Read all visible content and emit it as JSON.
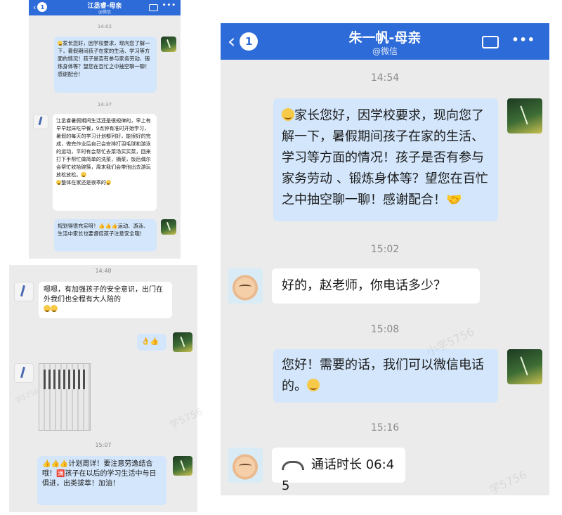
{
  "left_top": {
    "title": "江丞睿-母亲",
    "subtitle": "@微信",
    "back_count": "1",
    "times": [
      "14:02",
      "14:37"
    ],
    "msg1": "家长您好，因学校要求，现向您了解一下，暑假期间孩子在家的生活、学习等方面的情况！孩子是否有参与家务劳动、锻炼身体等？望您在百忙之中抽空聊一聊！感谢配合！",
    "msg2": "江丞睿暑假期间生活还是很规律的，早上有早早起床吃早餐，9点钟有准时开始学习，暑假的每天的学习计划都列好，能很好的完成，做完作业后自己会安排打羽毛球和游泳的运动，平时有会帮忙去菜场买买菜，回来打下手帮忙做简单的洗菜，摘菜，饭后偶尔会帮忙收拾碗筷，周末我们会带他出去游玩放松放松。",
    "msg2_tail": "整体在家还是很乖的",
    "msg3": "规划得很充实呀！👍👍👍运动、游泳、生活中家长也要督促孩子注意安全哦！"
  },
  "left_bottom": {
    "times": [
      "14:48",
      "15:07"
    ],
    "msg1": "嗯嗯，有加强孩子的安全意识，出门在外我们也全程有大人陪的",
    "msg2": "👌👍",
    "msg3": "👍👍👍计划周详！要注意劳逸结合哦！🈵孩子在以后的学习生活中与日俱进，出类拔萃！加油！"
  },
  "right": {
    "title": "朱一帆-母亲",
    "subtitle": "@微信",
    "back_count": "1",
    "times": [
      "14:54",
      "15:02",
      "15:08",
      "15:16"
    ],
    "msg1": "家长您好，因学校要求，现向您了解一下，暑假期间孩子在家的生活、学习等方面的情况！孩子是否有参与家务劳动 、锻炼身体等？望您在百忙之中抽空聊一聊！感谢配合！",
    "msg1_tail": "🤝",
    "msg2": "好的，赵老师，你电话多少？",
    "msg3": "您好！需要的话，我们可以微信电话的。",
    "call_label": "通话时长 06:45",
    "more_label": "•••"
  },
  "watermarks": [
    "小学5756",
    "学5756"
  ],
  "colors": {
    "header": "#2d6bd8",
    "bubble_sent": "#d3e6fb",
    "bubble_recv": "#ffffff",
    "chat_bg": "#ebebeb"
  }
}
